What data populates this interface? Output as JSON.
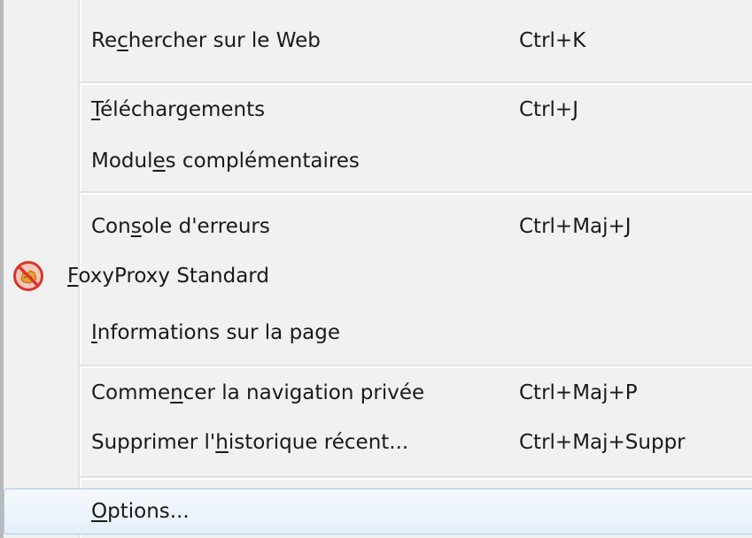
{
  "menu": {
    "items": [
      {
        "label_pre": "Re",
        "label_acc": "c",
        "label_post": "hercher sur le Web",
        "shortcut": "Ctrl+K"
      },
      {
        "label_pre": "",
        "label_acc": "T",
        "label_post": "éléchargements",
        "shortcut": "Ctrl+J"
      },
      {
        "label_pre": "Modul",
        "label_acc": "e",
        "label_post": "s complémentaires",
        "shortcut": ""
      },
      {
        "label_pre": "Con",
        "label_acc": "s",
        "label_post": "ole d'erreurs",
        "shortcut": "Ctrl+Maj+J"
      },
      {
        "label_pre": "",
        "label_acc": "F",
        "label_post": "oxyProxy Standard",
        "shortcut": "",
        "icon": "foxyproxy-disabled-icon"
      },
      {
        "label_pre": "",
        "label_acc": "I",
        "label_post": "nformations sur la page",
        "shortcut": ""
      },
      {
        "label_pre": "Comme",
        "label_acc": "n",
        "label_post": "cer la navigation privée",
        "shortcut": "Ctrl+Maj+P"
      },
      {
        "label_pre": "Supprimer l'",
        "label_acc": "h",
        "label_post": "istorique récent...",
        "shortcut": "Ctrl+Maj+Suppr"
      },
      {
        "label_pre": "",
        "label_acc": "O",
        "label_post": "ptions...",
        "shortcut": "",
        "state": "highlighted"
      }
    ]
  },
  "colors": {
    "menu_background": "#f1f1f1",
    "highlight_border": "#aac8ea",
    "highlight_fill": "#e5effa",
    "icon_red": "#d9352b",
    "icon_orange": "#e8a030"
  }
}
